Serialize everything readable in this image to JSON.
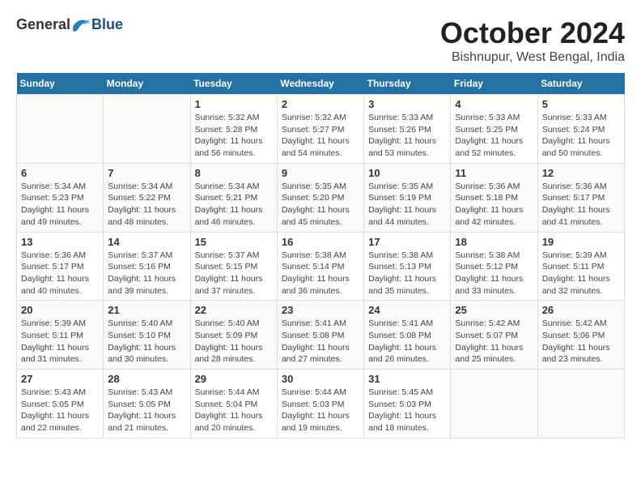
{
  "header": {
    "logo_general": "General",
    "logo_blue": "Blue",
    "month_title": "October 2024",
    "location": "Bishnupur, West Bengal, India"
  },
  "days_of_week": [
    "Sunday",
    "Monday",
    "Tuesday",
    "Wednesday",
    "Thursday",
    "Friday",
    "Saturday"
  ],
  "weeks": [
    [
      {
        "day": "",
        "sunrise": "",
        "sunset": "",
        "daylight": ""
      },
      {
        "day": "",
        "sunrise": "",
        "sunset": "",
        "daylight": ""
      },
      {
        "day": "1",
        "sunrise": "Sunrise: 5:32 AM",
        "sunset": "Sunset: 5:28 PM",
        "daylight": "Daylight: 11 hours and 56 minutes."
      },
      {
        "day": "2",
        "sunrise": "Sunrise: 5:32 AM",
        "sunset": "Sunset: 5:27 PM",
        "daylight": "Daylight: 11 hours and 54 minutes."
      },
      {
        "day": "3",
        "sunrise": "Sunrise: 5:33 AM",
        "sunset": "Sunset: 5:26 PM",
        "daylight": "Daylight: 11 hours and 53 minutes."
      },
      {
        "day": "4",
        "sunrise": "Sunrise: 5:33 AM",
        "sunset": "Sunset: 5:25 PM",
        "daylight": "Daylight: 11 hours and 52 minutes."
      },
      {
        "day": "5",
        "sunrise": "Sunrise: 5:33 AM",
        "sunset": "Sunset: 5:24 PM",
        "daylight": "Daylight: 11 hours and 50 minutes."
      }
    ],
    [
      {
        "day": "6",
        "sunrise": "Sunrise: 5:34 AM",
        "sunset": "Sunset: 5:23 PM",
        "daylight": "Daylight: 11 hours and 49 minutes."
      },
      {
        "day": "7",
        "sunrise": "Sunrise: 5:34 AM",
        "sunset": "Sunset: 5:22 PM",
        "daylight": "Daylight: 11 hours and 48 minutes."
      },
      {
        "day": "8",
        "sunrise": "Sunrise: 5:34 AM",
        "sunset": "Sunset: 5:21 PM",
        "daylight": "Daylight: 11 hours and 46 minutes."
      },
      {
        "day": "9",
        "sunrise": "Sunrise: 5:35 AM",
        "sunset": "Sunset: 5:20 PM",
        "daylight": "Daylight: 11 hours and 45 minutes."
      },
      {
        "day": "10",
        "sunrise": "Sunrise: 5:35 AM",
        "sunset": "Sunset: 5:19 PM",
        "daylight": "Daylight: 11 hours and 44 minutes."
      },
      {
        "day": "11",
        "sunrise": "Sunrise: 5:36 AM",
        "sunset": "Sunset: 5:18 PM",
        "daylight": "Daylight: 11 hours and 42 minutes."
      },
      {
        "day": "12",
        "sunrise": "Sunrise: 5:36 AM",
        "sunset": "Sunset: 5:17 PM",
        "daylight": "Daylight: 11 hours and 41 minutes."
      }
    ],
    [
      {
        "day": "13",
        "sunrise": "Sunrise: 5:36 AM",
        "sunset": "Sunset: 5:17 PM",
        "daylight": "Daylight: 11 hours and 40 minutes."
      },
      {
        "day": "14",
        "sunrise": "Sunrise: 5:37 AM",
        "sunset": "Sunset: 5:16 PM",
        "daylight": "Daylight: 11 hours and 39 minutes."
      },
      {
        "day": "15",
        "sunrise": "Sunrise: 5:37 AM",
        "sunset": "Sunset: 5:15 PM",
        "daylight": "Daylight: 11 hours and 37 minutes."
      },
      {
        "day": "16",
        "sunrise": "Sunrise: 5:38 AM",
        "sunset": "Sunset: 5:14 PM",
        "daylight": "Daylight: 11 hours and 36 minutes."
      },
      {
        "day": "17",
        "sunrise": "Sunrise: 5:38 AM",
        "sunset": "Sunset: 5:13 PM",
        "daylight": "Daylight: 11 hours and 35 minutes."
      },
      {
        "day": "18",
        "sunrise": "Sunrise: 5:38 AM",
        "sunset": "Sunset: 5:12 PM",
        "daylight": "Daylight: 11 hours and 33 minutes."
      },
      {
        "day": "19",
        "sunrise": "Sunrise: 5:39 AM",
        "sunset": "Sunset: 5:11 PM",
        "daylight": "Daylight: 11 hours and 32 minutes."
      }
    ],
    [
      {
        "day": "20",
        "sunrise": "Sunrise: 5:39 AM",
        "sunset": "Sunset: 5:11 PM",
        "daylight": "Daylight: 11 hours and 31 minutes."
      },
      {
        "day": "21",
        "sunrise": "Sunrise: 5:40 AM",
        "sunset": "Sunset: 5:10 PM",
        "daylight": "Daylight: 11 hours and 30 minutes."
      },
      {
        "day": "22",
        "sunrise": "Sunrise: 5:40 AM",
        "sunset": "Sunset: 5:09 PM",
        "daylight": "Daylight: 11 hours and 28 minutes."
      },
      {
        "day": "23",
        "sunrise": "Sunrise: 5:41 AM",
        "sunset": "Sunset: 5:08 PM",
        "daylight": "Daylight: 11 hours and 27 minutes."
      },
      {
        "day": "24",
        "sunrise": "Sunrise: 5:41 AM",
        "sunset": "Sunset: 5:08 PM",
        "daylight": "Daylight: 11 hours and 26 minutes."
      },
      {
        "day": "25",
        "sunrise": "Sunrise: 5:42 AM",
        "sunset": "Sunset: 5:07 PM",
        "daylight": "Daylight: 11 hours and 25 minutes."
      },
      {
        "day": "26",
        "sunrise": "Sunrise: 5:42 AM",
        "sunset": "Sunset: 5:06 PM",
        "daylight": "Daylight: 11 hours and 23 minutes."
      }
    ],
    [
      {
        "day": "27",
        "sunrise": "Sunrise: 5:43 AM",
        "sunset": "Sunset: 5:05 PM",
        "daylight": "Daylight: 11 hours and 22 minutes."
      },
      {
        "day": "28",
        "sunrise": "Sunrise: 5:43 AM",
        "sunset": "Sunset: 5:05 PM",
        "daylight": "Daylight: 11 hours and 21 minutes."
      },
      {
        "day": "29",
        "sunrise": "Sunrise: 5:44 AM",
        "sunset": "Sunset: 5:04 PM",
        "daylight": "Daylight: 11 hours and 20 minutes."
      },
      {
        "day": "30",
        "sunrise": "Sunrise: 5:44 AM",
        "sunset": "Sunset: 5:03 PM",
        "daylight": "Daylight: 11 hours and 19 minutes."
      },
      {
        "day": "31",
        "sunrise": "Sunrise: 5:45 AM",
        "sunset": "Sunset: 5:03 PM",
        "daylight": "Daylight: 11 hours and 18 minutes."
      },
      {
        "day": "",
        "sunrise": "",
        "sunset": "",
        "daylight": ""
      },
      {
        "day": "",
        "sunrise": "",
        "sunset": "",
        "daylight": ""
      }
    ]
  ]
}
